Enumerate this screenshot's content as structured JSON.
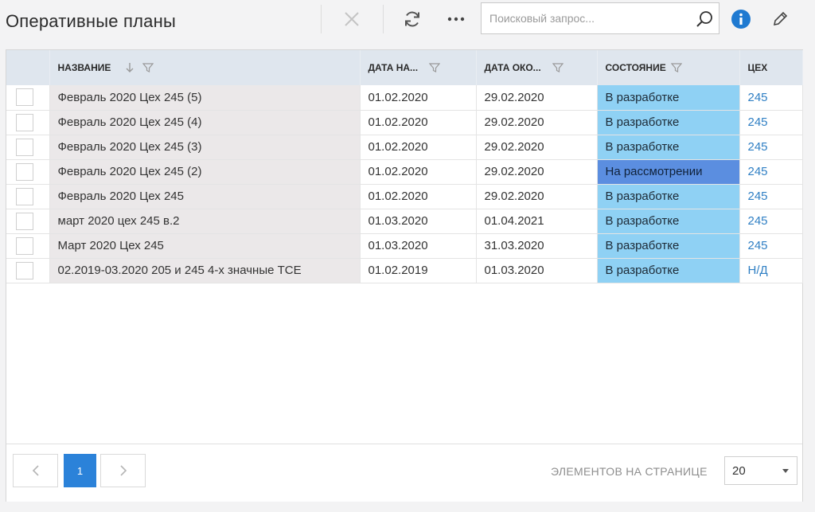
{
  "header": {
    "title": "Оперативные планы",
    "search_placeholder": "Поисковый запрос..."
  },
  "toolbar": {
    "icons": [
      "close-icon",
      "refresh-icon",
      "more-icon",
      "search-icon",
      "info-icon",
      "pencil-icon"
    ],
    "accent": "#2b82d9"
  },
  "table": {
    "columns": [
      {
        "label": ""
      },
      {
        "label": "Название"
      },
      {
        "label": "Дата на..."
      },
      {
        "label": "Дата око..."
      },
      {
        "label": "Состояние"
      },
      {
        "label": "Цех"
      }
    ],
    "rows": [
      {
        "name": "Февраль 2020 Цех 245 (5)",
        "start": "01.02.2020",
        "end": "29.02.2020",
        "state": "В разработке",
        "dept": "245"
      },
      {
        "name": "Февраль 2020 Цех 245 (4)",
        "start": "01.02.2020",
        "end": "29.02.2020",
        "state": "В разработке",
        "dept": "245"
      },
      {
        "name": "Февраль 2020 Цех 245 (3)",
        "start": "01.02.2020",
        "end": "29.02.2020",
        "state": "В разработке",
        "dept": "245"
      },
      {
        "name": "Февраль 2020 Цех 245 (2)",
        "start": "01.02.2020",
        "end": "29.02.2020",
        "state": "На рассмотрении",
        "dept": "245"
      },
      {
        "name": "Февраль 2020 Цех 245",
        "start": "01.02.2020",
        "end": "29.02.2020",
        "state": "В разработке",
        "dept": "245"
      },
      {
        "name": "март 2020 цех 245 в.2",
        "start": "01.03.2020",
        "end": "01.04.2021",
        "state": "В разработке",
        "dept": "245"
      },
      {
        "name": "Март 2020 Цех 245",
        "start": "01.03.2020",
        "end": "31.03.2020",
        "state": "В разработке",
        "dept": "245"
      },
      {
        "name": "02.2019-03.2020 205 и 245 4-х значные ТСЕ",
        "start": "01.02.2019",
        "end": "01.03.2020",
        "state": "В разработке",
        "dept": "Н/Д"
      }
    ],
    "state_colors": {
      "В разработке": "#8fd1f4",
      "На рассмотрении": "#5b8ee0"
    }
  },
  "pager": {
    "current_page": "1",
    "per_page_label": "ЭЛЕМЕНТОВ НА СТРАНИЦЕ",
    "per_page_value": "20"
  }
}
